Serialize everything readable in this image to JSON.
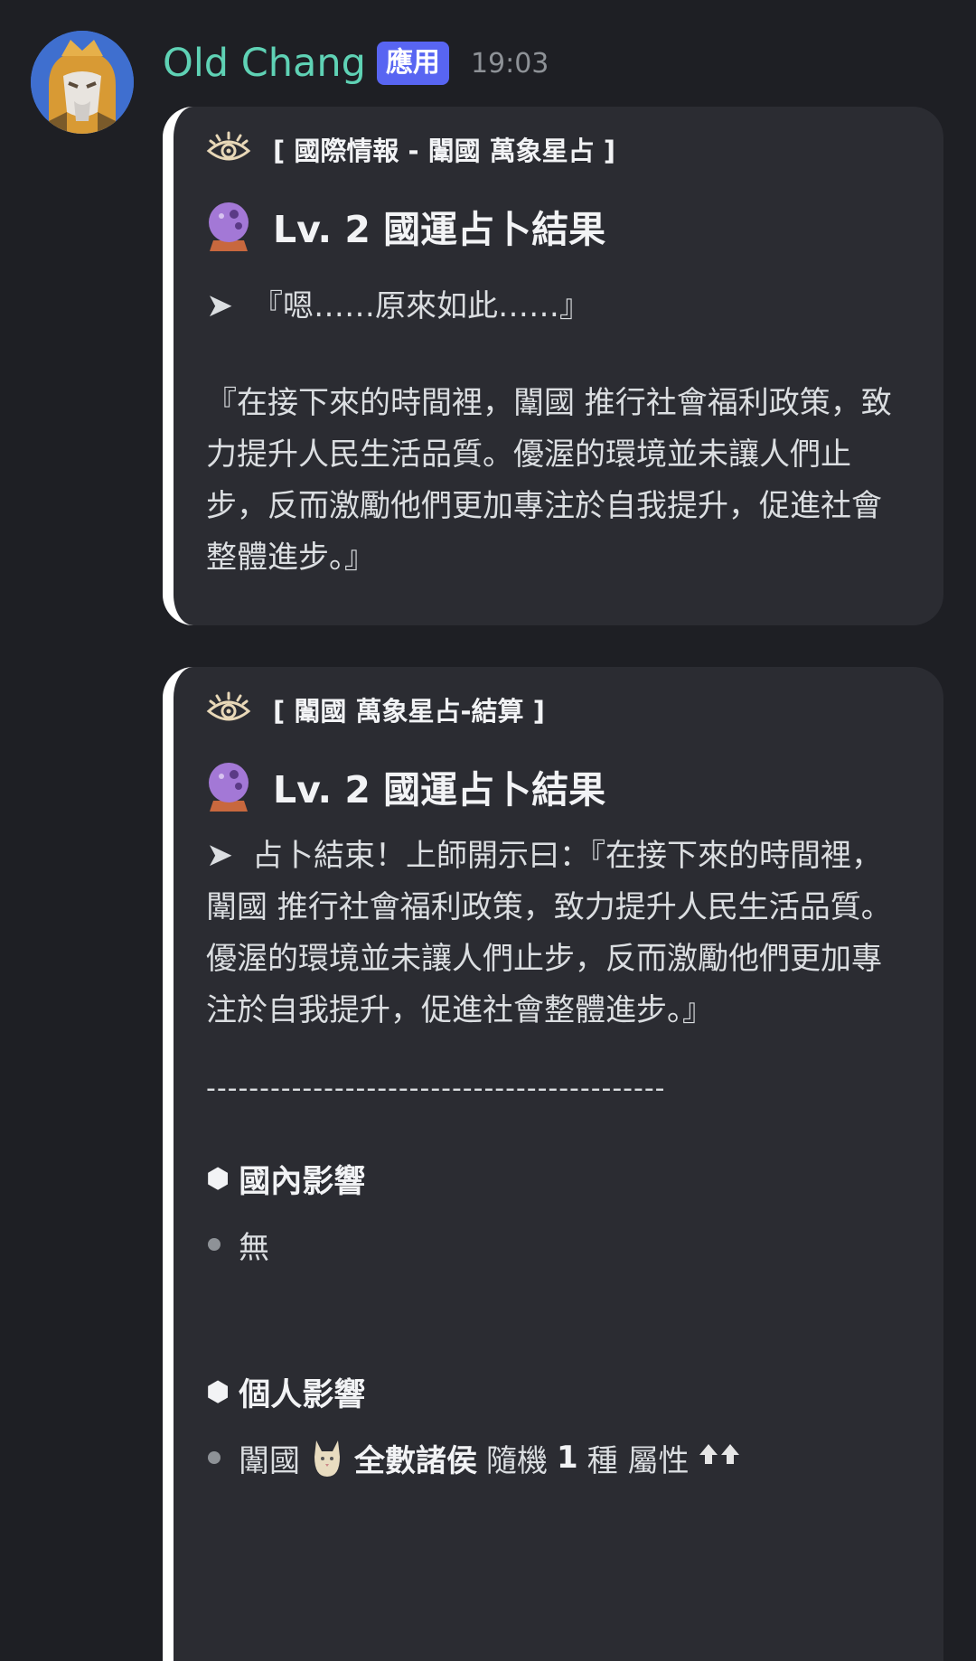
{
  "message": {
    "username": "Old Chang",
    "badge": "應用",
    "timestamp": "19:03"
  },
  "embed1": {
    "author": "[ 國際情報 - 闈國 萬象星占 ]",
    "title": "Lv. 2 國運占卜結果",
    "arrow_line": "『嗯……原來如此……』",
    "paragraph": "『在接下來的時間裡，闈國 推行社會福利政策，致力提升人民生活品質。優渥的環境並未讓人們止步，反而激勵他們更加專注於自我提升，促進社會整體進步。』"
  },
  "embed2": {
    "author": "[ 闈國 萬象星占-結算 ]",
    "title": "Lv. 2 國運占卜結果",
    "paragraph": "占卜結束！上師開示曰：『在接下來的時間裡，闈國 推行社會福利政策，致力提升人民生活品質。優渥的環境並未讓人們止步，反而激勵他們更加專注於自我提升，促進社會整體進步。』",
    "divider": "-------------------------------------------",
    "domestic": {
      "heading": "國內影響",
      "items": [
        "無"
      ]
    },
    "personal": {
      "heading": "個人影響",
      "item": {
        "country": "闈國",
        "target": "全數諸侯",
        "text1": "隨機",
        "count": "1",
        "text2": "種 屬性"
      }
    }
  },
  "icons": [
    "eye-icon",
    "crystal-ball-icon",
    "cat-icon",
    "double-up-arrow-icon",
    "hexagon-bullet-icon"
  ],
  "colors": {
    "username": "#5fd2b5",
    "badge": "#5865f2",
    "embed_bg": "#2b2c32",
    "page_bg": "#1e1f24",
    "crystal_ball": "#9d6bd2"
  }
}
